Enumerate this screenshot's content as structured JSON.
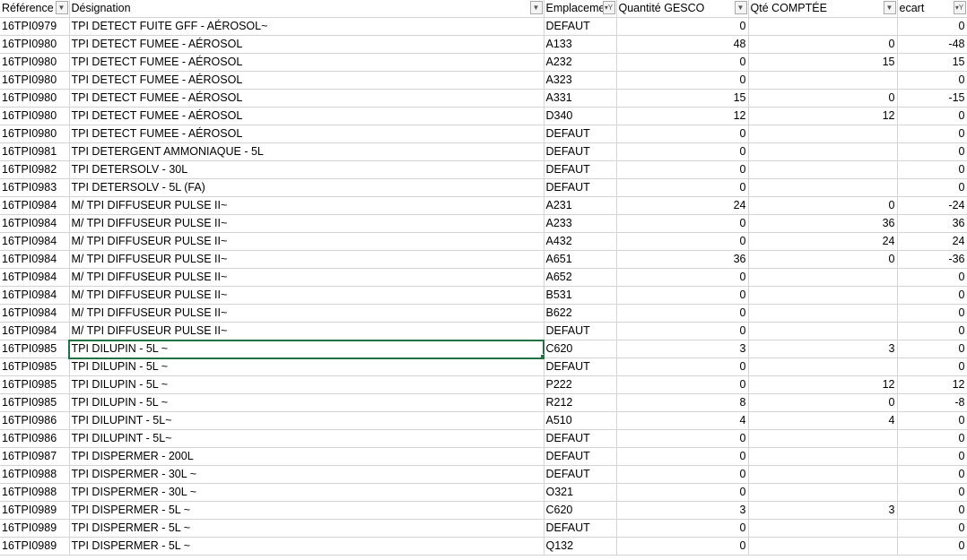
{
  "headers": [
    {
      "label": "Référence",
      "filter": "dropdown"
    },
    {
      "label": "Désignation",
      "filter": "dropdown"
    },
    {
      "label": "Emplacement",
      "filter": "filtered"
    },
    {
      "label": "Quantité GESCO",
      "filter": "dropdown"
    },
    {
      "label": "Qté COMPTÉE",
      "filter": "dropdown"
    },
    {
      "label": "ecart",
      "filter": "filtered"
    }
  ],
  "rows": [
    [
      "16TPI0979",
      "TPI DETECT FUITE GFF - AÉROSOL~",
      "DEFAUT",
      "0",
      "",
      "0"
    ],
    [
      "16TPI0980",
      "TPI DETECT FUMEE - AÉROSOL",
      "A133",
      "48",
      "0",
      "-48"
    ],
    [
      "16TPI0980",
      "TPI DETECT FUMEE - AÉROSOL",
      "A232",
      "0",
      "15",
      "15"
    ],
    [
      "16TPI0980",
      "TPI DETECT FUMEE - AÉROSOL",
      "A323",
      "0",
      "",
      "0"
    ],
    [
      "16TPI0980",
      "TPI DETECT FUMEE - AÉROSOL",
      "A331",
      "15",
      "0",
      "-15"
    ],
    [
      "16TPI0980",
      "TPI DETECT FUMEE - AÉROSOL",
      "D340",
      "12",
      "12",
      "0"
    ],
    [
      "16TPI0980",
      "TPI DETECT FUMEE - AÉROSOL",
      "DEFAUT",
      "0",
      "",
      "0"
    ],
    [
      "16TPI0981",
      "TPI DETERGENT AMMONIAQUE - 5L",
      "DEFAUT",
      "0",
      "",
      "0"
    ],
    [
      "16TPI0982",
      "TPI DETERSOLV - 30L",
      "DEFAUT",
      "0",
      "",
      "0"
    ],
    [
      "16TPI0983",
      "TPI DETERSOLV - 5L (FA)",
      "DEFAUT",
      "0",
      "",
      "0"
    ],
    [
      "16TPI0984",
      "M/ TPI DIFFUSEUR PULSE II~",
      "A231",
      "24",
      "0",
      "-24"
    ],
    [
      "16TPI0984",
      "M/ TPI DIFFUSEUR PULSE II~",
      "A233",
      "0",
      "36",
      "36"
    ],
    [
      "16TPI0984",
      "M/ TPI DIFFUSEUR PULSE II~",
      "A432",
      "0",
      "24",
      "24"
    ],
    [
      "16TPI0984",
      "M/ TPI DIFFUSEUR PULSE II~",
      "A651",
      "36",
      "0",
      "-36"
    ],
    [
      "16TPI0984",
      "M/ TPI DIFFUSEUR PULSE II~",
      "A652",
      "0",
      "",
      "0"
    ],
    [
      "16TPI0984",
      "M/ TPI DIFFUSEUR PULSE II~",
      "B531",
      "0",
      "",
      "0"
    ],
    [
      "16TPI0984",
      "M/ TPI DIFFUSEUR PULSE II~",
      "B622",
      "0",
      "",
      "0"
    ],
    [
      "16TPI0984",
      "M/ TPI DIFFUSEUR PULSE II~",
      "DEFAUT",
      "0",
      "",
      "0"
    ],
    [
      "16TPI0985",
      "TPI DILUPIN - 5L ~",
      "C620",
      "3",
      "3",
      "0"
    ],
    [
      "16TPI0985",
      "TPI DILUPIN - 5L ~",
      "DEFAUT",
      "0",
      "",
      "0"
    ],
    [
      "16TPI0985",
      "TPI DILUPIN - 5L ~",
      "P222",
      "0",
      "12",
      "12"
    ],
    [
      "16TPI0985",
      "TPI DILUPIN - 5L ~",
      "R212",
      "8",
      "0",
      "-8"
    ],
    [
      "16TPI0986",
      "TPI DILUPINT - 5L~",
      "A510",
      "4",
      "4",
      "0"
    ],
    [
      "16TPI0986",
      "TPI DILUPINT - 5L~",
      "DEFAUT",
      "0",
      "",
      "0"
    ],
    [
      "16TPI0987",
      "TPI DISPERMER - 200L",
      "DEFAUT",
      "0",
      "",
      "0"
    ],
    [
      "16TPI0988",
      "TPI DISPERMER - 30L ~",
      "DEFAUT",
      "0",
      "",
      "0"
    ],
    [
      "16TPI0988",
      "TPI DISPERMER - 30L ~",
      "O321",
      "0",
      "",
      "0"
    ],
    [
      "16TPI0989",
      "TPI DISPERMER - 5L ~",
      "C620",
      "3",
      "3",
      "0"
    ],
    [
      "16TPI0989",
      "TPI DISPERMER - 5L ~",
      "DEFAUT",
      "0",
      "",
      "0"
    ],
    [
      "16TPI0989",
      "TPI DISPERMER - 5L ~",
      "Q132",
      "0",
      "",
      "0"
    ]
  ],
  "selected_row": 18,
  "selected_col": 1
}
